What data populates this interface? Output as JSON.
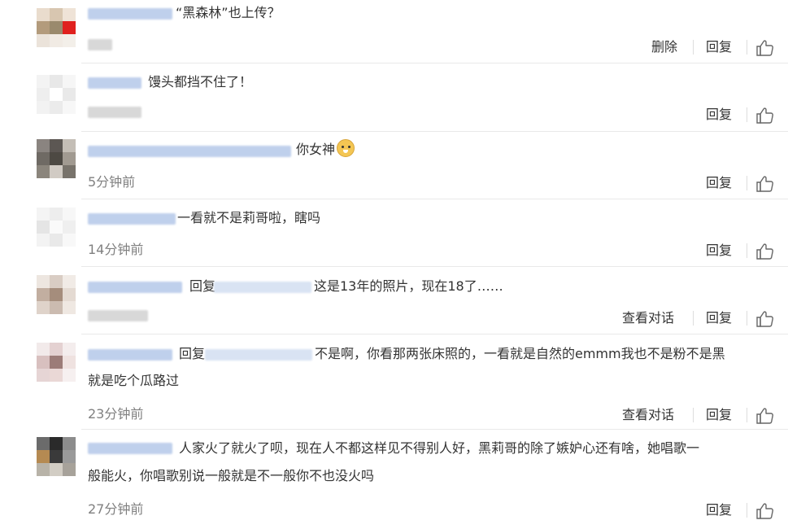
{
  "actions": {
    "delete": "删除",
    "reply": "回复",
    "view_conversation": "查看对话"
  },
  "icons": {
    "like": "thumbs-up-icon",
    "emoji": "doge-emoji-icon"
  },
  "comments": [
    {
      "text": "“黑森林”也上传？",
      "time": ""
    },
    {
      "text": "馒头都挡不住了！",
      "time": ""
    },
    {
      "text": "你女神",
      "time": "5分钟前"
    },
    {
      "text": "一看就不是莉哥啦，瞎吗",
      "time": "14分钟前"
    },
    {
      "reply_prefix": "回复",
      "text": "这是13年的照片，现在18了……",
      "time": ""
    },
    {
      "reply_prefix": "回复",
      "text_line1": "不是啊，你看那两张床照的，一看就是自然的emmm我也不是粉不是黑",
      "text_line2": "就是吃个瓜路过",
      "time": "23分钟前"
    },
    {
      "text_line1": "人家火了就火了呗，现在人不都这样见不得别人好，黑莉哥的除了嫉妒心还有啥，她唱歌一",
      "text_line2": "般能火，你唱歌别说一般就是不一般你不也没火吗",
      "time": "27分钟前"
    }
  ]
}
